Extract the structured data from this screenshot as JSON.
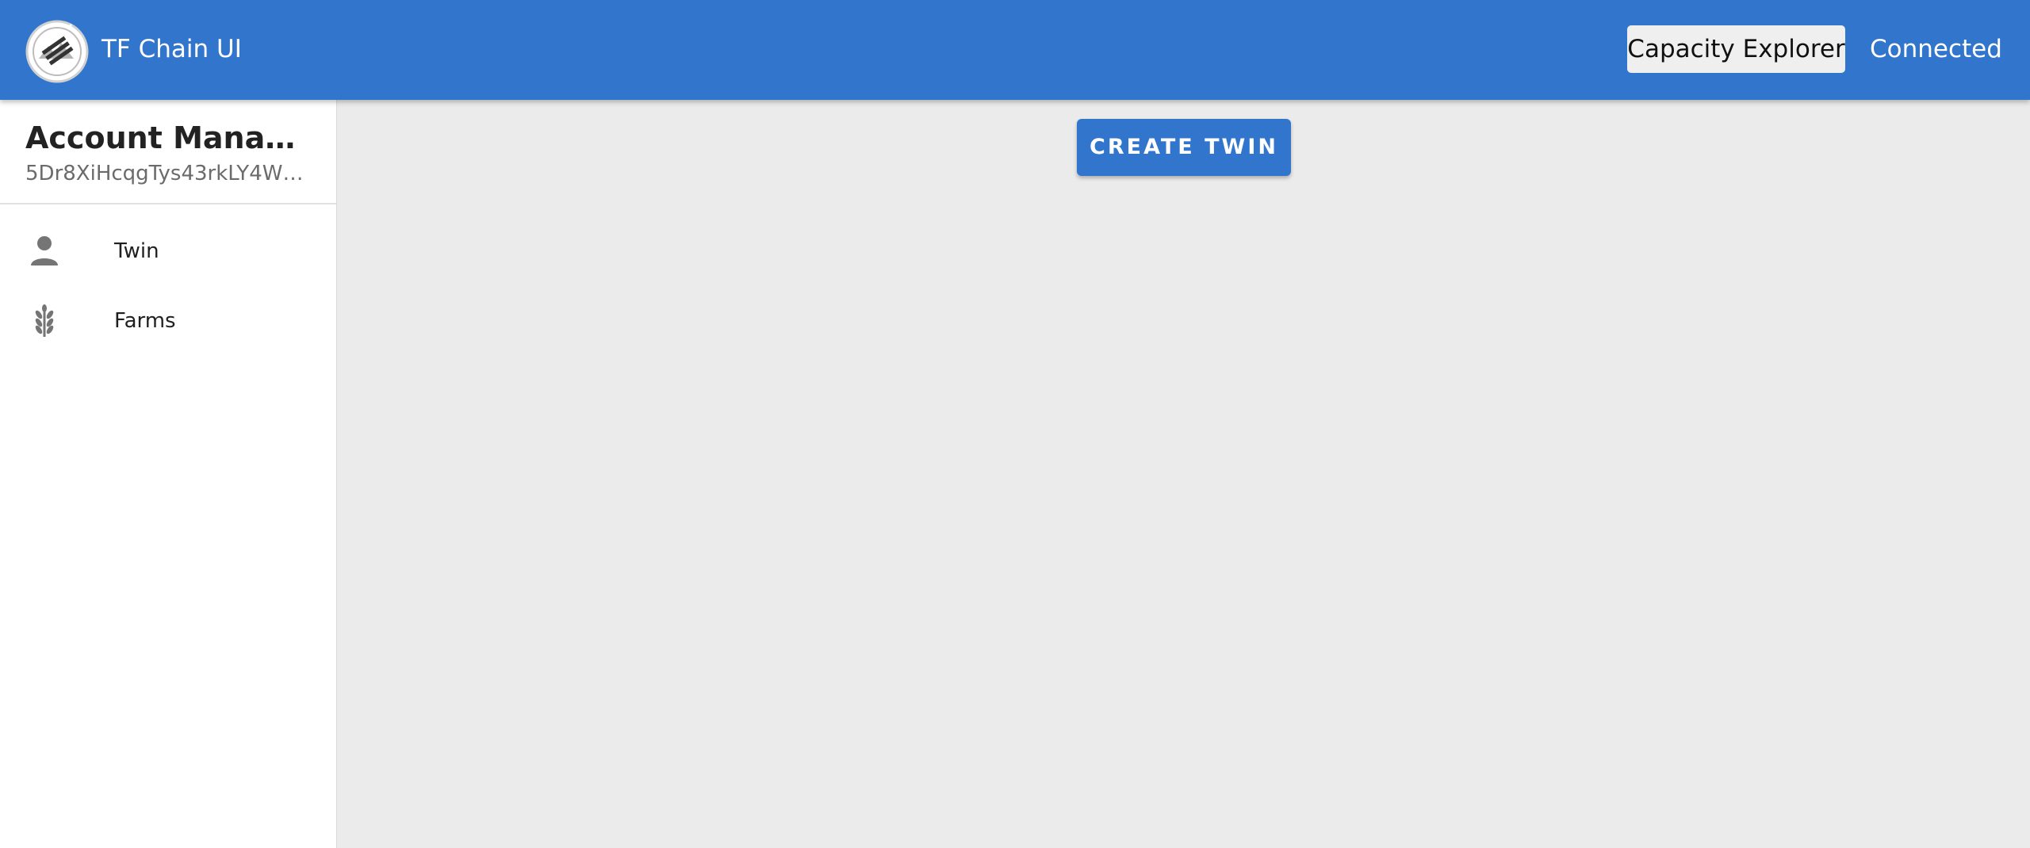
{
  "appbar": {
    "title": "TF Chain UI",
    "logo_icon": "tf-chain-logo-icon",
    "explorer_label": "Capacity Explorer",
    "status_label": "Connected",
    "bar_color": "#3175cd"
  },
  "sidebar": {
    "account_title": "Account Manage…",
    "account_address": "5Dr8XiHcqgTys43rkLY4Wd…",
    "items": [
      {
        "label": "Twin",
        "icon": "person-icon"
      },
      {
        "label": "Farms",
        "icon": "wheat-icon"
      }
    ]
  },
  "main": {
    "create_twin_label": "CREATE TWIN"
  }
}
